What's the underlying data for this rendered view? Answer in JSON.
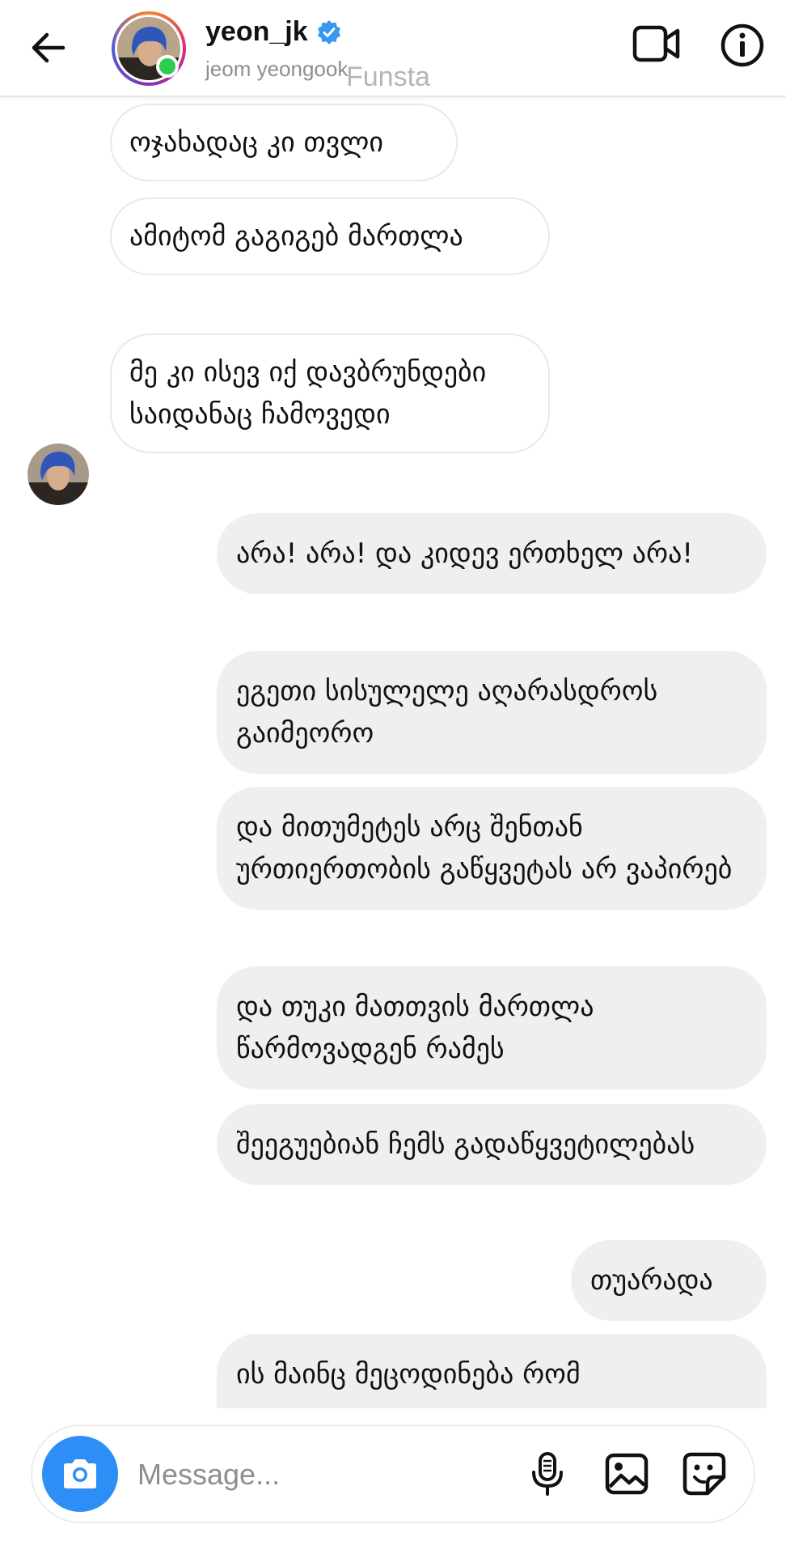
{
  "header": {
    "username": "yeon_jk",
    "subname": "jeom yeongook",
    "watermark": "Funsta",
    "online_color": "#2ecc54",
    "verified_color": "#3897f0",
    "icons": {
      "back": "arrow-left-icon",
      "video": "video-camera-icon",
      "info": "info-circle-icon",
      "verified": "verified-badge-icon"
    }
  },
  "messages": {
    "incoming": [
      "ოჯახადაც კი თვლი",
      "ამიტომ გაგიგებ მართლა",
      "მე კი ისევ იქ დავბრუნდები საიდანაც ჩამოვედი"
    ],
    "outgoing": [
      "არა! არა! და კიდევ ერთხელ არა!",
      "ეგეთი სისულელე აღარასდროს გაიმეორო",
      "და მითუმეტეს არც შენთან ურთიერთობის გაწყვეტას არ ვაპირებ",
      "და თუკი მათთვის მართლა წარმოვადგენ რამეს",
      "შეეგუებიან ჩემს გადაწყვეტილებას",
      "თუარადა",
      "ის მაინც მეცოდინება რომ"
    ]
  },
  "composer": {
    "placeholder": "Message...",
    "accent_color": "#2d8ff5",
    "icons": {
      "camera": "camera-icon",
      "mic": "microphone-icon",
      "gallery": "gallery-image-icon",
      "sticker": "sticker-icon"
    }
  }
}
